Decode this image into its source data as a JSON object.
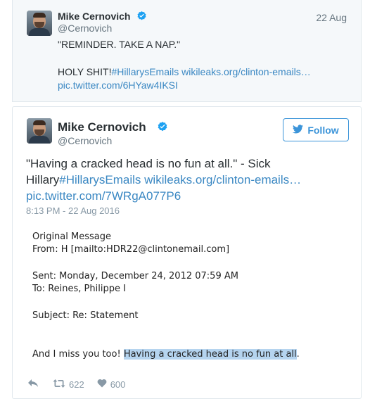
{
  "parent_tweet": {
    "name": "Mike Cernovich",
    "handle": "@Cernovich",
    "date": "22 Aug",
    "line1": "\"REMINDER. TAKE A NAP.\"",
    "line2_text": "HOLY SHIT!",
    "line2_hashtag": "#HillarysEmails",
    "line2_link": "wikileaks.org/clinton-emails…",
    "line3_link": "pic.twitter.com/6HYaw4IKSI",
    "verified_icon": "verified-badge-icon"
  },
  "main_tweet": {
    "name": "Mike Cernovich",
    "handle": "@Cernovich",
    "follow_label": "Follow",
    "body_line1": "\"Having a cracked head is no fun at all.\" - Sick",
    "body_line2_text": "Hillary",
    "body_line2_hashtag": "#HillarysEmails",
    "body_line2_link": "wikileaks.org/clinton-emails…",
    "body_line3_link": "pic.twitter.com/7WRgA077P6",
    "timestamp": "8:13 PM - 22 Aug 2016",
    "retweet_count": "622",
    "like_count": "600",
    "accent_color": "#3b94d9"
  },
  "email_image": {
    "line1": "Original Message",
    "line2": "From: H [mailto:HDR22@clintonemail.com]",
    "line3": "Sent: Monday, December 24, 2012 07:59 AM",
    "line4": "To: Reines, Philippe I",
    "line5": "Subject: Re: Statement",
    "line6_plain": "And I miss you too! ",
    "line6_highlight": "Having a cracked head is no fun at all",
    "line6_end": "."
  }
}
